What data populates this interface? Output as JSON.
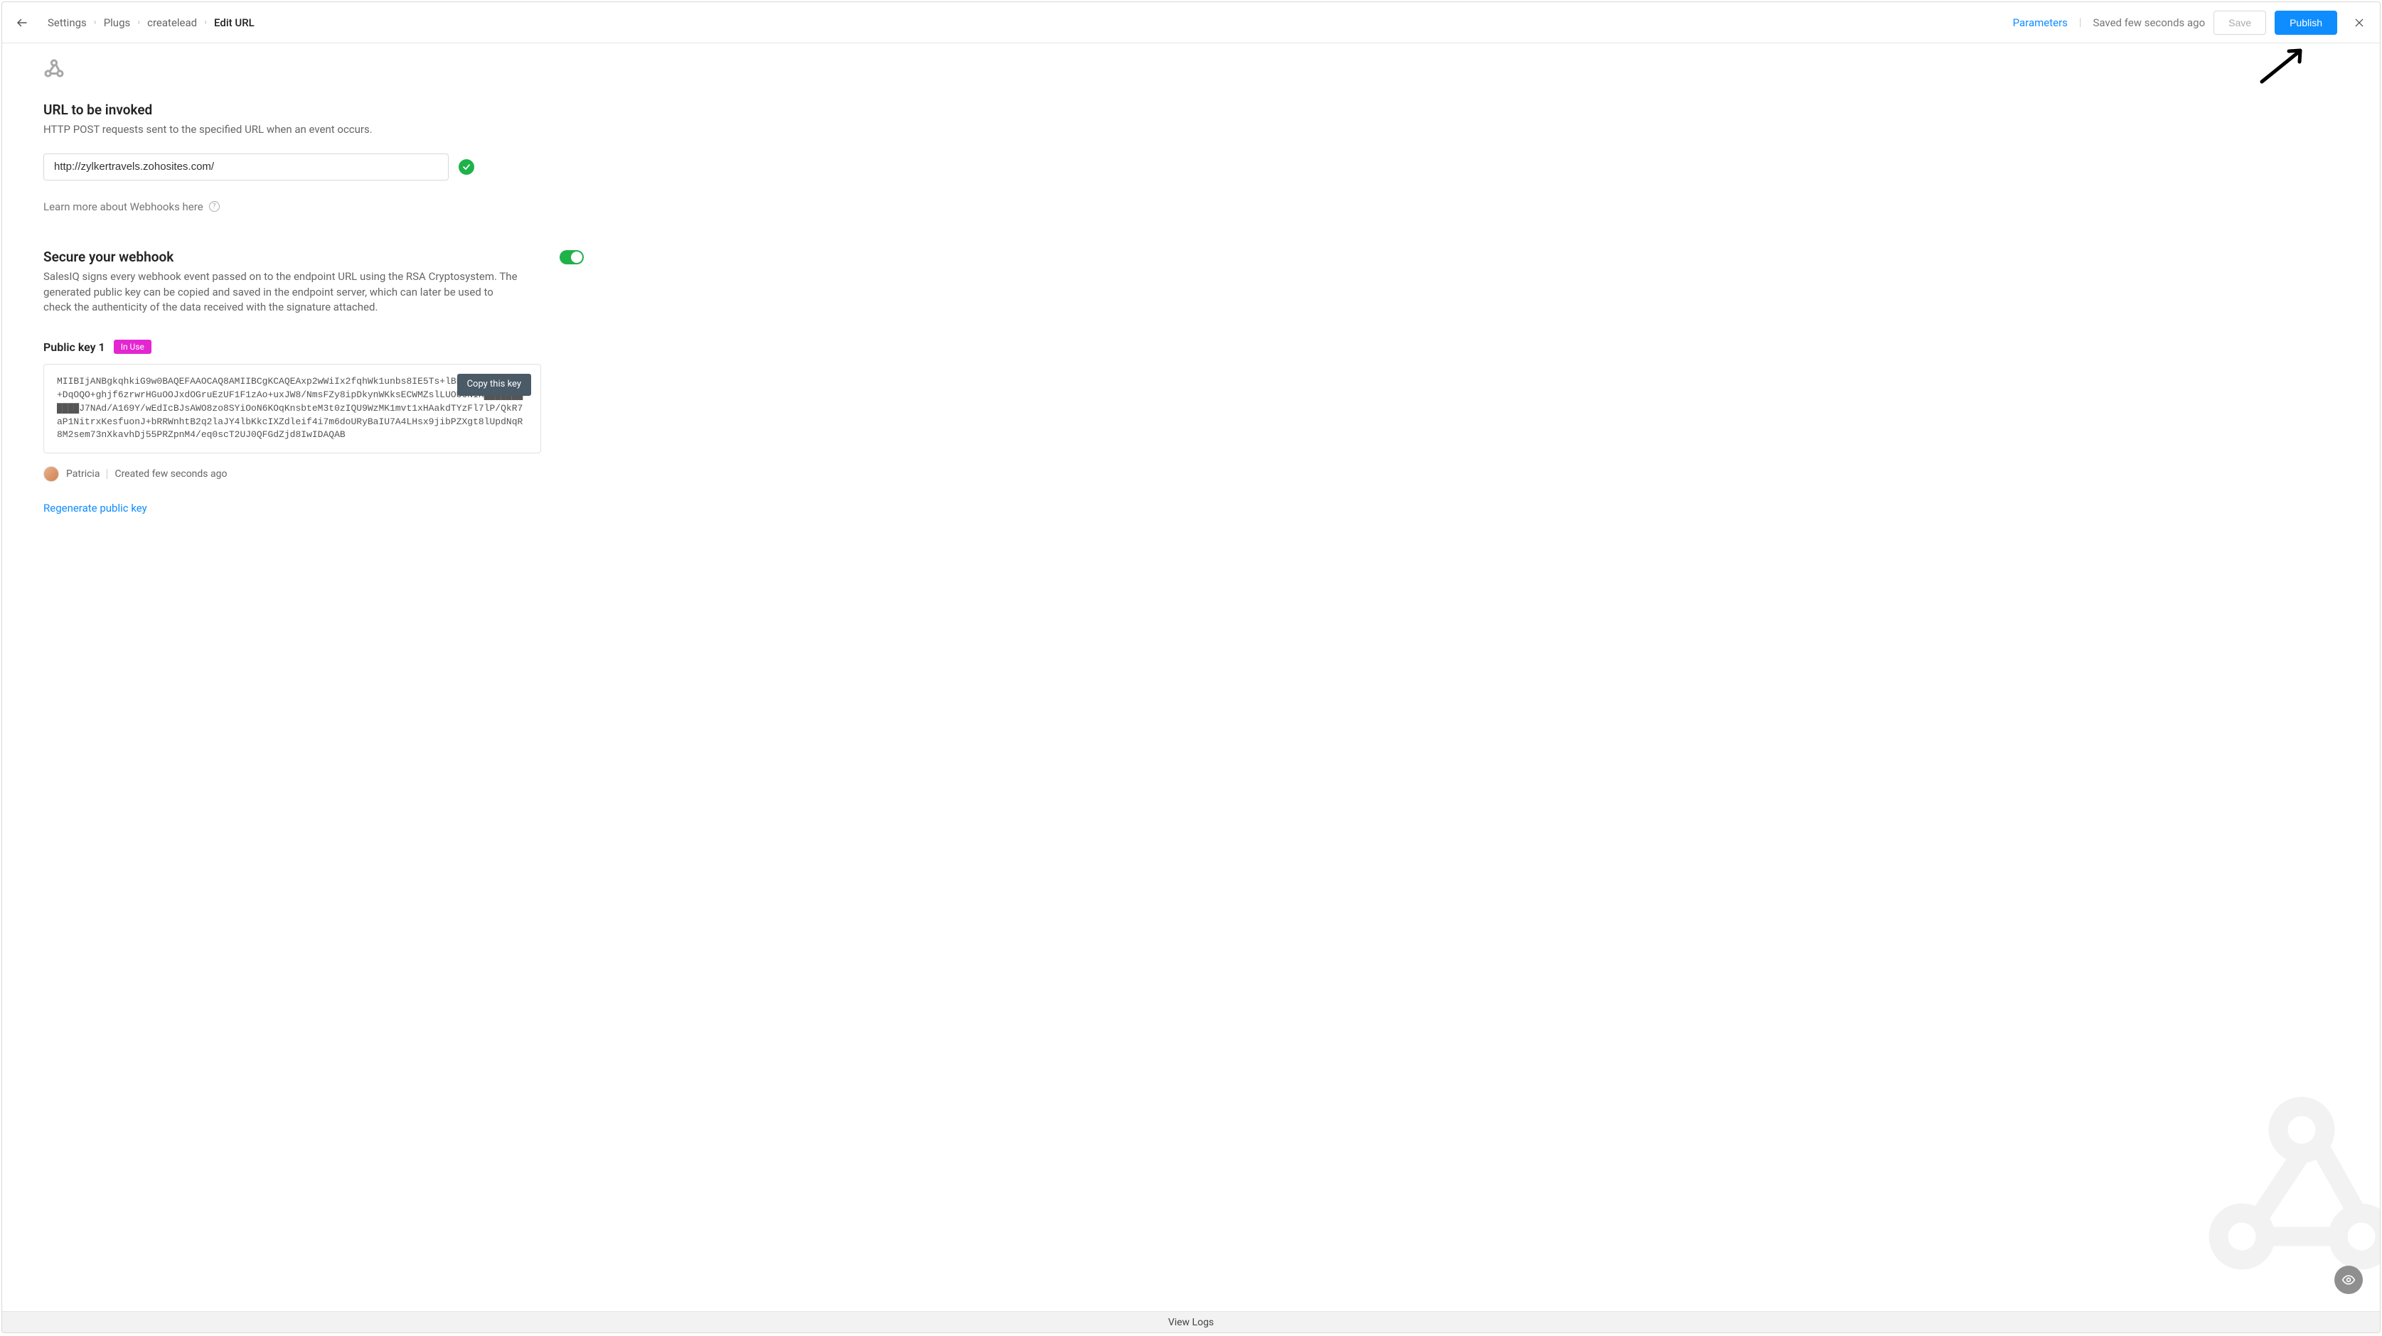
{
  "header": {
    "crumbs": [
      "Settings",
      "Plugs",
      "createlead",
      "Edit URL"
    ],
    "parameters_label": "Parameters",
    "saved_text": "Saved few seconds ago",
    "save_label": "Save",
    "publish_label": "Publish"
  },
  "url_section": {
    "title": "URL to be invoked",
    "desc": "HTTP POST requests sent to the specified URL when an event occurs.",
    "value": "http://zylkertravels.zohosites.com/",
    "learn_more": "Learn more about Webhooks here"
  },
  "secure_section": {
    "title": "Secure your webhook",
    "desc": "SalesIQ signs every webhook event passed on to the endpoint URL using the RSA Cryptosystem. The generated public key can be copied and saved in the endpoint server, which can later be used to check the authenticity of the data received with the signature attached.",
    "toggle_on": true
  },
  "public_key": {
    "label": "Public key 1",
    "badge": "In Use",
    "value": "MIIBIjANBgkqhkiG9w0BAQEFAAOCAQ8AMIIBCgKCAQEAxp2wWiIx2fqhWk1unbs8IE5Ts+lBHmhpq██████++DqOQO+ghjf6zrwrHGuOOJxdOGruEzUF1F1zAo+uxJW8/NmsFZy8ipDkynWKksECWMZslLUOUONIK███████████J7NAd/A169Y/wEdIcBJsAWO8zo8SYiOoN6KOqKnsbteM3t0zIQU9WzMK1mvt1xHAakdTYzFl7lP/QkR7aP1NitrxKesfuonJ+bRRWnhtB2q2laJY4lbKkcIXZdleif4i7m6doURyBaIU7A4LHsx9jibPZXgt8lUpdNqR8M2sem73nXkavhDj55PRZpnM4/eq0scT2UJ0QFGdZjd8IwIDAQAB",
    "copy_label": "Copy this key",
    "creator_name": "Patricia",
    "created_text": "Created few seconds ago",
    "regenerate_label": "Regenerate public key"
  },
  "footer": {
    "view_logs": "View Logs"
  }
}
